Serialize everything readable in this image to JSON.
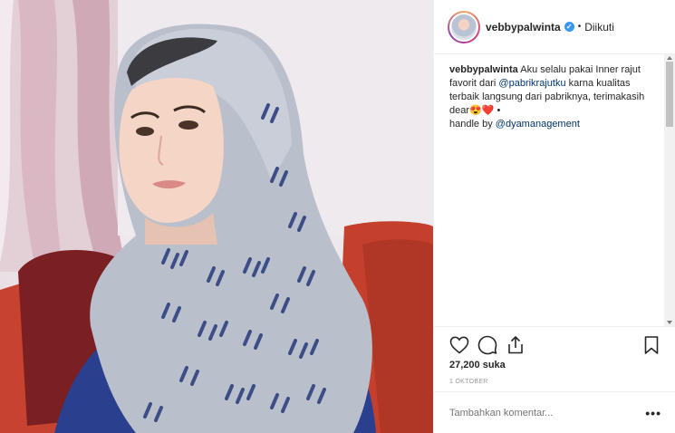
{
  "post": {
    "username": "vebbypalwinta",
    "verified_icon": "verified-badge-icon",
    "separator": "•",
    "follow_status": "Diikuti",
    "caption": {
      "username": "vebbypalwinta",
      "text_1": "Aku selalu pakai Inner rajut favorit dari",
      "mention_1": "@pabrikrajutku",
      "text_2": "karna kualitas terbaik langsung dari pabriknya, terimakasih dear",
      "emojis": "😍❤️",
      "text_3": "•",
      "handle_prefix": "handle by",
      "mention_2": "@dyamanagement"
    },
    "likes": "27,200 suka",
    "date": "1 OKTOBER",
    "comment_placeholder": "Tambahkan komentar...",
    "more_label": "•••"
  },
  "icons": {
    "like": "heart-icon",
    "comment": "comment-bubble-icon",
    "share": "share-icon",
    "save": "bookmark-icon"
  },
  "colors": {
    "mention": "#003569",
    "verified": "#3897f0",
    "muted": "#999999",
    "text": "#262626"
  }
}
